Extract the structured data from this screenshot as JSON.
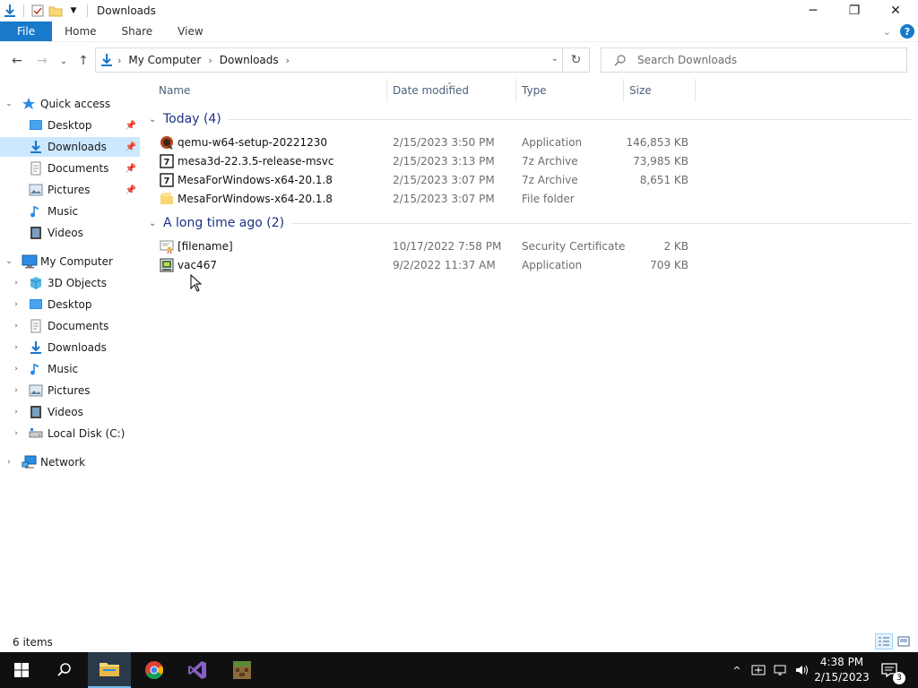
{
  "window": {
    "title": "Downloads",
    "controls": {
      "minimize": "─",
      "maximize": "❐",
      "close": "✕"
    }
  },
  "ribbon": {
    "tabs": [
      {
        "label": "File"
      },
      {
        "label": "Home"
      },
      {
        "label": "Share"
      },
      {
        "label": "View"
      }
    ],
    "help_label": "?"
  },
  "nav": {
    "back": "←",
    "forward": "→",
    "recent": "⌄",
    "up": "↑"
  },
  "address": {
    "crumbs": [
      {
        "label": "My Computer"
      },
      {
        "label": "Downloads"
      }
    ],
    "refresh": "↻"
  },
  "search": {
    "placeholder": "Search Downloads"
  },
  "sidebar": {
    "items": [
      {
        "label": "Quick access",
        "icon": "star-icon",
        "expander": "⌄",
        "pinned": false
      },
      {
        "label": "Desktop",
        "icon": "desktop-icon",
        "expander": "",
        "pinned": true
      },
      {
        "label": "Downloads",
        "icon": "download-icon",
        "expander": "",
        "pinned": true,
        "selected": true
      },
      {
        "label": "Documents",
        "icon": "documents-icon",
        "expander": "",
        "pinned": true
      },
      {
        "label": "Pictures",
        "icon": "pictures-icon",
        "expander": "",
        "pinned": true
      },
      {
        "label": "Music",
        "icon": "music-icon",
        "expander": "",
        "pinned": false
      },
      {
        "label": "Videos",
        "icon": "videos-icon",
        "expander": "",
        "pinned": false
      },
      {
        "label": "My Computer",
        "icon": "computer-icon",
        "expander": "⌄",
        "pinned": false
      },
      {
        "label": "3D Objects",
        "icon": "3d-objects-icon",
        "expander": "›",
        "pinned": false
      },
      {
        "label": "Desktop",
        "icon": "desktop-icon",
        "expander": "›",
        "pinned": false
      },
      {
        "label": "Documents",
        "icon": "documents-icon",
        "expander": "›",
        "pinned": false
      },
      {
        "label": "Downloads",
        "icon": "download-icon",
        "expander": "›",
        "pinned": false
      },
      {
        "label": "Music",
        "icon": "music-icon",
        "expander": "›",
        "pinned": false
      },
      {
        "label": "Pictures",
        "icon": "pictures-icon",
        "expander": "›",
        "pinned": false
      },
      {
        "label": "Videos",
        "icon": "videos-icon",
        "expander": "›",
        "pinned": false
      },
      {
        "label": "Local Disk (C:)",
        "icon": "drive-icon",
        "expander": "›",
        "pinned": false
      },
      {
        "label": "Network",
        "icon": "network-icon",
        "expander": "›",
        "pinned": false
      }
    ]
  },
  "columns": [
    {
      "label": "Name"
    },
    {
      "label": "Date modified"
    },
    {
      "label": "Type"
    },
    {
      "label": "Size"
    }
  ],
  "groups": [
    {
      "label": "Today (4)",
      "files": [
        {
          "name": "qemu-w64-setup-20221230",
          "date": "2/15/2023 3:50 PM",
          "type": "Application",
          "size": "146,853 KB",
          "icon": "installer-icon"
        },
        {
          "name": "mesa3d-22.3.5-release-msvc",
          "date": "2/15/2023 3:13 PM",
          "type": "7z Archive",
          "size": "73,985 KB",
          "icon": "archive-icon"
        },
        {
          "name": "MesaForWindows-x64-20.1.8",
          "date": "2/15/2023 3:07 PM",
          "type": "7z Archive",
          "size": "8,651 KB",
          "icon": "archive-icon"
        },
        {
          "name": "MesaForWindows-x64-20.1.8",
          "date": "2/15/2023 3:07 PM",
          "type": "File folder",
          "size": "",
          "icon": "folder-icon"
        }
      ]
    },
    {
      "label": "A long time ago (2)",
      "files": [
        {
          "name": "[filename]",
          "date": "10/17/2022 7:58 PM",
          "type": "Security Certificate",
          "size": "2 KB",
          "icon": "certificate-icon"
        },
        {
          "name": "vac467",
          "date": "9/2/2022 11:37 AM",
          "type": "Application",
          "size": "709 KB",
          "icon": "app-icon"
        }
      ]
    }
  ],
  "status": {
    "item_count": "6 items"
  },
  "taskbar": {
    "apps": [
      {
        "name": "file-explorer-icon",
        "active": true
      },
      {
        "name": "chrome-icon",
        "active": false
      },
      {
        "name": "visual-studio-icon",
        "active": false
      },
      {
        "name": "minecraft-icon",
        "active": false
      }
    ],
    "clock_time": "4:38 PM",
    "clock_date": "2/15/2023",
    "notification_count": "3",
    "tray_chevron": "^"
  },
  "colors": {
    "accent": "#1979ca",
    "selection": "#cce8ff",
    "group_header": "#1e3287",
    "column_header": "#4c607a",
    "taskbar": "#101010"
  }
}
